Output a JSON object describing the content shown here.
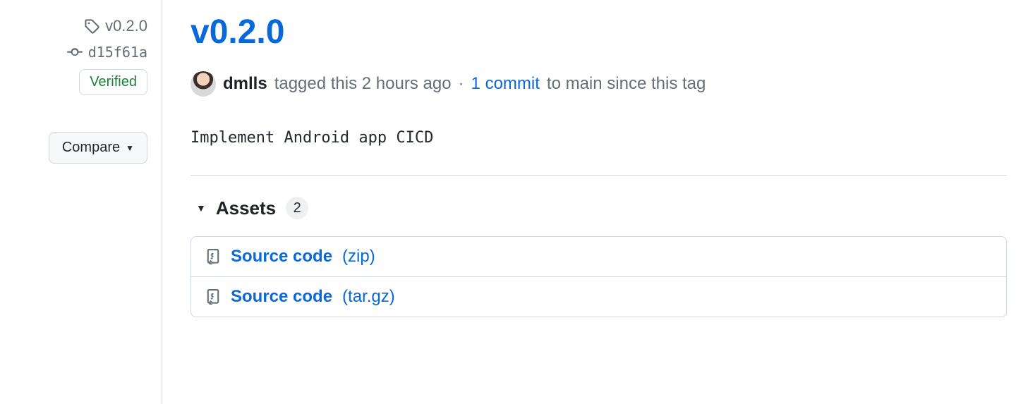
{
  "sidebar": {
    "tag": "v0.2.0",
    "commit": "d15f61a",
    "verified_label": "Verified",
    "compare_label": "Compare"
  },
  "release": {
    "title": "v0.2.0",
    "author": "dmlls",
    "tagged_text": "tagged this 2 hours ago",
    "sep": " · ",
    "commits_link": "1 commit",
    "commits_suffix": " to main since this tag",
    "description": "Implement Android app CICD"
  },
  "assets": {
    "label": "Assets",
    "count": "2",
    "items": [
      {
        "name": "Source code",
        "ext": "(zip)"
      },
      {
        "name": "Source code",
        "ext": "(tar.gz)"
      }
    ]
  }
}
